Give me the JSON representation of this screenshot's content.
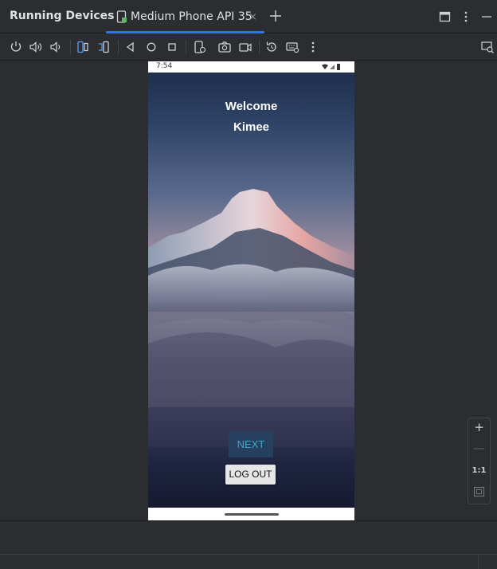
{
  "panel": {
    "title": "Running Devices"
  },
  "tab": {
    "label": "Medium Phone API 35",
    "close": "×",
    "add": "+"
  },
  "toolbar": {
    "icons": [
      "power-icon",
      "volume-up-icon",
      "volume-down-icon",
      "rotate-left-icon",
      "rotate-right-icon",
      "back-icon",
      "home-icon",
      "overview-icon",
      "device-frame-icon",
      "screenshot-icon",
      "screen-record-icon",
      "reset-icon",
      "keyboard-icon",
      "more-icon",
      "device-mirror-icon"
    ]
  },
  "phone": {
    "status_time": "7:54",
    "welcome_line1": "Welcome",
    "welcome_line2": "Kimee",
    "next_label": "NEXT",
    "logout_label": "LOG OUT"
  },
  "zoom": {
    "plus": "+",
    "minus": "—",
    "one_to_one": "1:1"
  },
  "colors": {
    "accent": "#3574f0",
    "background": "#2b2d30",
    "next_text": "#3ba8c8"
  }
}
